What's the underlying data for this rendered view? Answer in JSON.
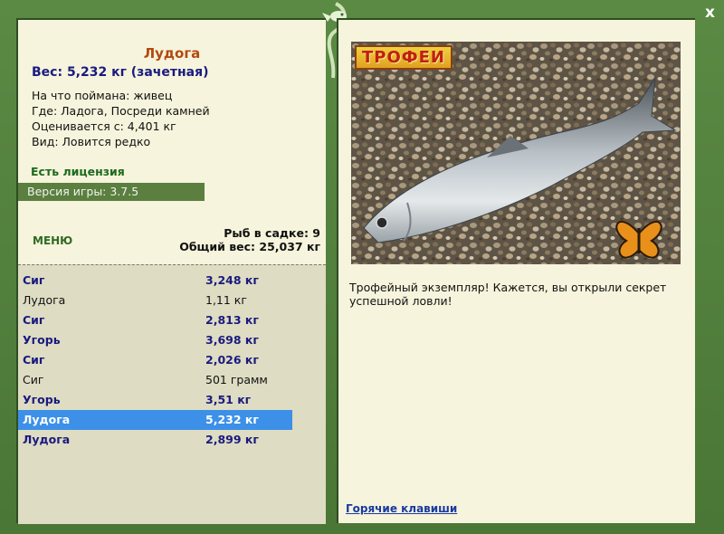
{
  "window": {
    "close_label": "x"
  },
  "fish": {
    "title": "Лудога",
    "weight": "Вес: 5,232 кг (зачетная)",
    "info": [
      "На что поймана: живец",
      "Где: Ладога, Посреди камней",
      "Оценивается с: 4,401 кг",
      "Вид: Ловится редко"
    ],
    "license": "Есть лицензия",
    "version": "Версия игры: 3.7.5"
  },
  "menu": {
    "label": "МЕНЮ"
  },
  "keep": {
    "count": "Рыб в садке: 9",
    "total": "Общий вес: 25,037 кг"
  },
  "catch_list": [
    {
      "name": "Сиг",
      "weight": "3,248 кг",
      "trophy": true,
      "selected": false
    },
    {
      "name": "Лудога",
      "weight": "1,11 кг",
      "trophy": false,
      "selected": false
    },
    {
      "name": "Сиг",
      "weight": "2,813 кг",
      "trophy": true,
      "selected": false
    },
    {
      "name": "Угорь",
      "weight": "3,698 кг",
      "trophy": true,
      "selected": false
    },
    {
      "name": "Сиг",
      "weight": "2,026 кг",
      "trophy": true,
      "selected": false
    },
    {
      "name": "Сиг",
      "weight": "501 грамм",
      "trophy": false,
      "selected": false
    },
    {
      "name": "Угорь",
      "weight": "3,51 кг",
      "trophy": true,
      "selected": false
    },
    {
      "name": "Лудога",
      "weight": "5,232 кг",
      "trophy": true,
      "selected": true
    },
    {
      "name": "Лудога",
      "weight": "2,899 кг",
      "trophy": true,
      "selected": false
    }
  ],
  "photo": {
    "badge": "ТРОФЕИ"
  },
  "description": "Трофейный экземпляр! Кажется, вы открыли секрет успешной ловли!",
  "hotkeys": {
    "label": "Горячие клавиши"
  },
  "colors": {
    "frame": "#4e7a3a",
    "panel": "#f6f4dc",
    "list_bg": "#dedcc2",
    "selected": "#3c90e8",
    "trophy_text": "#1a1a80",
    "title": "#b24a10"
  }
}
